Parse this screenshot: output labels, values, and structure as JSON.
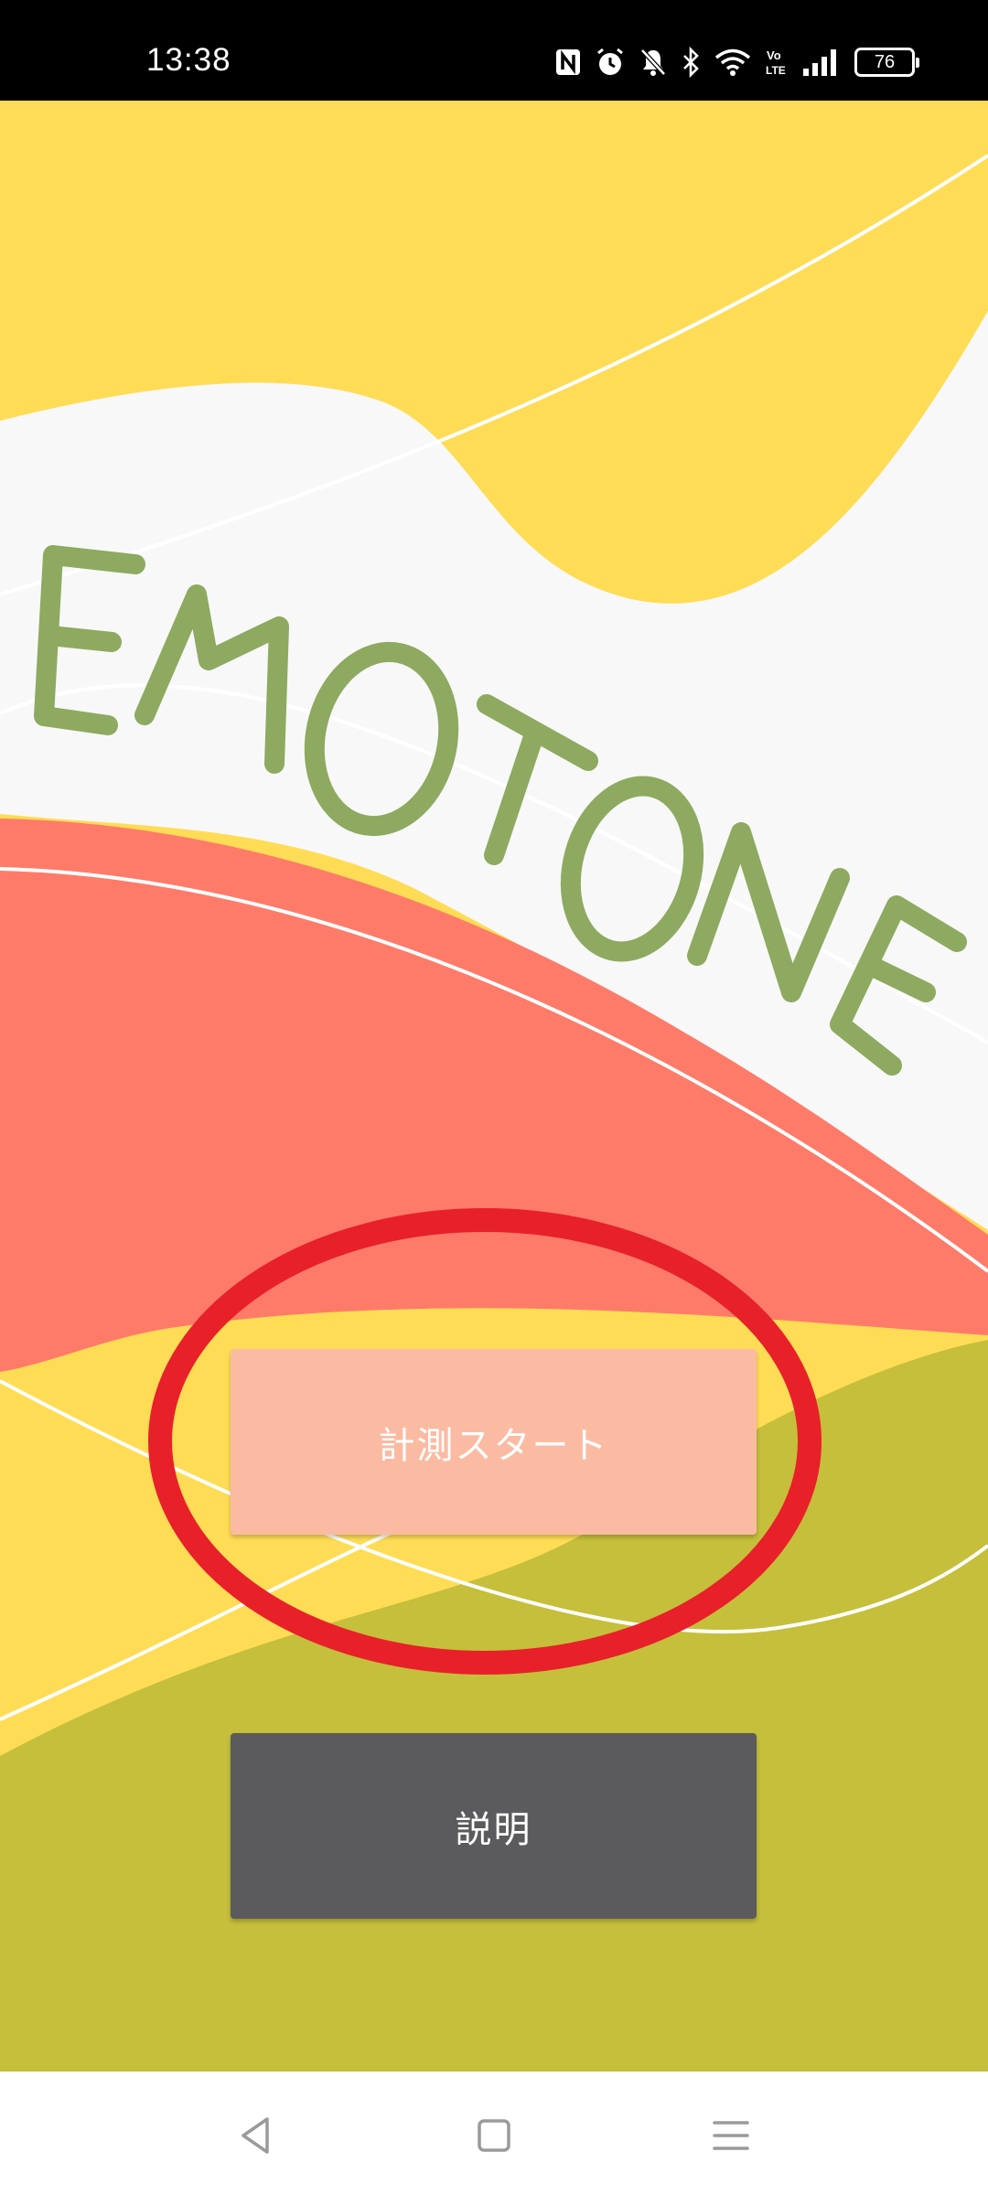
{
  "status_bar": {
    "time": "13:38",
    "battery": "76",
    "icons": [
      "nfc-icon",
      "alarm-icon",
      "bell-off-icon",
      "bluetooth-icon",
      "wifi-icon",
      "volte-icon",
      "signal-icon",
      "battery-icon"
    ]
  },
  "app": {
    "title": "EMOTONE",
    "start_button": "計測スタート",
    "info_button": "説明"
  },
  "colors": {
    "yellow": "#FFDC55",
    "white": "#F8F8F8",
    "coral": "#FF7B69",
    "olive": "#C5BF3B",
    "title_green": "#8DAA60",
    "start_button_bg": "#FBBBA3",
    "info_button_bg": "#5B5A5C",
    "annotation_red": "#E8202A"
  },
  "nav_bar": {
    "icons": [
      "back-icon",
      "home-icon",
      "menu-icon"
    ]
  }
}
